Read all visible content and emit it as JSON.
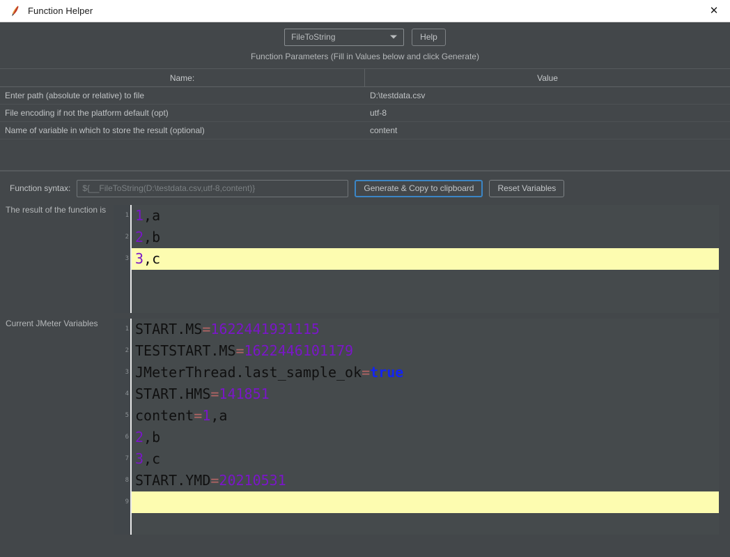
{
  "window": {
    "title": "Function Helper",
    "icon": "jmeter-feather-icon",
    "close_label": "✕"
  },
  "toolbar": {
    "function_select": {
      "value": "FileToString",
      "options": [
        "FileToString"
      ]
    },
    "help_label": "Help"
  },
  "parameters": {
    "caption": "Function Parameters (Fill in Values below and click Generate)",
    "columns": [
      "Name:",
      "Value"
    ],
    "rows": [
      {
        "name": "Enter path (absolute or relative) to file",
        "value": "D:\\testdata.csv"
      },
      {
        "name": "File encoding if not the platform default (opt)",
        "value": "utf-8"
      },
      {
        "name": "Name of variable in which to store the result (optional)",
        "value": "content"
      }
    ]
  },
  "syntax": {
    "label": "Function syntax:",
    "value": "${__FileToString(D:\\testdata.csv,utf-8,content)}",
    "placeholder": "${__FileToString(D:\\testdata.csv,utf-8,content)}"
  },
  "actions": {
    "generate_label": "Generate & Copy to clipboard",
    "reset_label": "Reset Variables",
    "focus_color": "#3b86c6"
  },
  "result": {
    "label": "The result of the function is",
    "lines": [
      {
        "n": "1",
        "tokens": [
          {
            "t": "1",
            "c": "num"
          },
          {
            "t": ",a",
            "c": "plain"
          }
        ],
        "highlight": false
      },
      {
        "n": "2",
        "tokens": [
          {
            "t": "2",
            "c": "num"
          },
          {
            "t": ",b",
            "c": "plain"
          }
        ],
        "highlight": false
      },
      {
        "n": "3",
        "tokens": [
          {
            "t": "3",
            "c": "num"
          },
          {
            "t": ",c",
            "c": "plain"
          }
        ],
        "highlight": true
      },
      {
        "n": "",
        "tokens": [],
        "highlight": false
      },
      {
        "n": "",
        "tokens": [],
        "highlight": false
      }
    ]
  },
  "variables": {
    "label": "Current JMeter Variables",
    "lines": [
      {
        "n": "1",
        "tokens": [
          {
            "t": "START.MS",
            "c": "key"
          },
          {
            "t": "=",
            "c": "eq"
          },
          {
            "t": "1622441931115",
            "c": "num"
          }
        ],
        "highlight": false
      },
      {
        "n": "2",
        "tokens": [
          {
            "t": "TESTSTART.MS",
            "c": "key"
          },
          {
            "t": "=",
            "c": "eq"
          },
          {
            "t": "1622446101179",
            "c": "num"
          }
        ],
        "highlight": false
      },
      {
        "n": "3",
        "tokens": [
          {
            "t": "JMeterThread.last_sample_ok",
            "c": "key"
          },
          {
            "t": "=",
            "c": "eq"
          },
          {
            "t": "true",
            "c": "bool"
          }
        ],
        "highlight": false
      },
      {
        "n": "4",
        "tokens": [
          {
            "t": "START.HMS",
            "c": "key"
          },
          {
            "t": "=",
            "c": "eq"
          },
          {
            "t": "141851",
            "c": "num"
          }
        ],
        "highlight": false
      },
      {
        "n": "5",
        "tokens": [
          {
            "t": "content",
            "c": "key"
          },
          {
            "t": "=",
            "c": "eq"
          },
          {
            "t": "1",
            "c": "num"
          },
          {
            "t": ",a",
            "c": "plain"
          }
        ],
        "highlight": false
      },
      {
        "n": "6",
        "tokens": [
          {
            "t": "2",
            "c": "num"
          },
          {
            "t": ",b",
            "c": "plain"
          }
        ],
        "highlight": false
      },
      {
        "n": "7",
        "tokens": [
          {
            "t": "3",
            "c": "num"
          },
          {
            "t": ",c",
            "c": "plain"
          }
        ],
        "highlight": false
      },
      {
        "n": "8",
        "tokens": [
          {
            "t": "START.YMD",
            "c": "key"
          },
          {
            "t": "=",
            "c": "eq"
          },
          {
            "t": "20210531",
            "c": "num"
          }
        ],
        "highlight": false
      },
      {
        "n": "9",
        "tokens": [],
        "highlight": true
      },
      {
        "n": "",
        "tokens": [],
        "highlight": false
      }
    ]
  },
  "theme": {
    "window_bg": "#43474a",
    "titlebar_bg": "#ffffff",
    "editor_bg": "#454a4c",
    "highlight": "#fdfcb0",
    "number_color": "#7a16c8",
    "bool_color": "#1324f0",
    "equals_color": "#b36565"
  }
}
